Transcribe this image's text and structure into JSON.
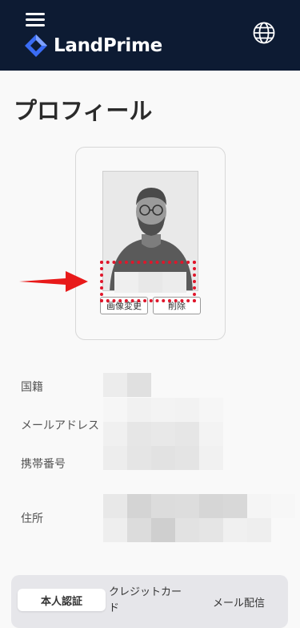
{
  "header": {
    "brand": "LandPrime",
    "menu_icon": "hamburger-menu-icon",
    "language_icon": "globe-icon",
    "background": "#0d1b33",
    "logo_color": "#3a6cf4"
  },
  "page": {
    "title": "プロフィール"
  },
  "photo_card": {
    "change_label": "画像変更",
    "delete_label": "削除"
  },
  "annotation": {
    "highlight_color": "#e0162b",
    "arrow_icon": "red-arrow-right-icon"
  },
  "fields": {
    "nationality_label": "国籍",
    "email_label": "メールアドレス",
    "phone_label": "携帯番号",
    "address_label": "住所"
  },
  "tabs": {
    "identity": "本人認証",
    "credit_card": "クレジットカード",
    "mail_delivery": "メール配信"
  }
}
